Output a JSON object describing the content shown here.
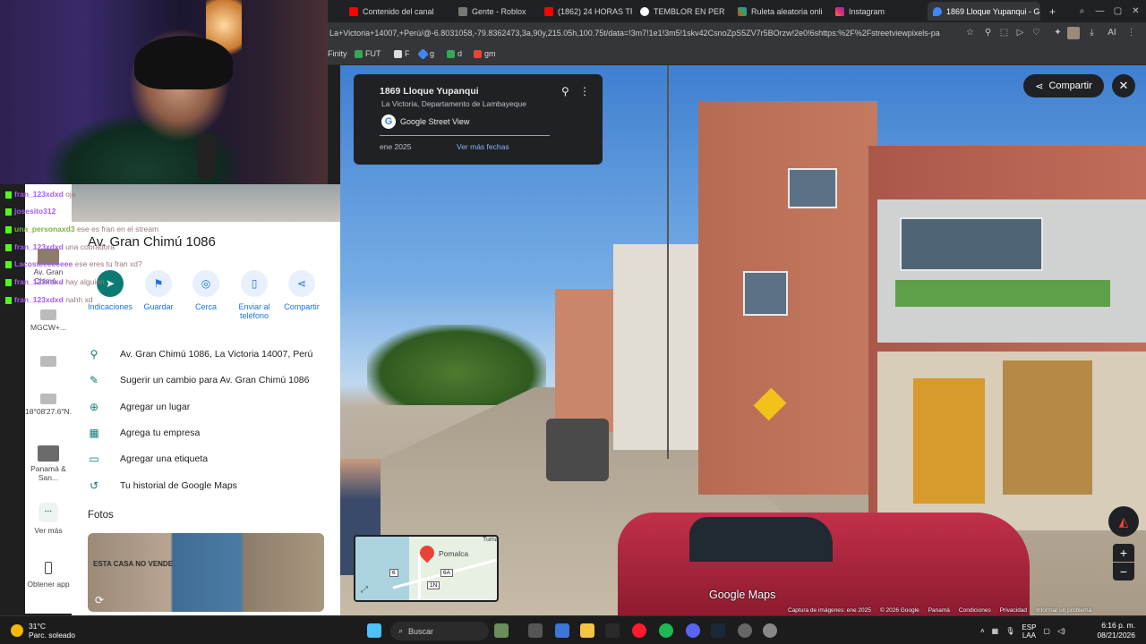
{
  "browser": {
    "tabs": [
      {
        "label": "Contenido del canal",
        "color": "#ff0000"
      },
      {
        "label": "Gente - Roblox",
        "color": "#555555"
      },
      {
        "label": "(1862) 24 HORAS TR",
        "color": "#ff0000"
      },
      {
        "label": "TEMBLOR EN PERU",
        "color": "#34a853"
      },
      {
        "label": "Ruleta aleatoria onlin",
        "color": "#9c27b0"
      },
      {
        "label": "Instagram",
        "color": "#e1306c"
      },
      {
        "label": "1869 Lloque Yupanqui - G",
        "color": "#4285f4"
      }
    ],
    "new_tab": "+",
    "url": "La+Victoria+14007,+Perú/@-6.8031058,-79.8362473,3a,90y,215.05h,100.75t/data=!3m7!1e1!3m5!1skv42CsnoZpS5ZV7r5BOrzw!2e0!6shttps:%2F%2Fstreetviewpixels-pa",
    "ai_label": "AI",
    "bookmarks": [
      {
        "label": "Finity",
        "color": ""
      },
      {
        "label": "FUT",
        "color": "#34a853"
      },
      {
        "label": "F",
        "color": "#4285f4"
      },
      {
        "label": "g",
        "color": "#4285f4"
      },
      {
        "label": "d",
        "color": "#34a853"
      },
      {
        "label": "gm",
        "color": "#ea4335"
      }
    ]
  },
  "chat": [
    {
      "user": "fran_123xdxd",
      "msg": "oja"
    },
    {
      "user": "josesito312",
      "msg": ""
    },
    {
      "user": "una_personaxd3",
      "msg": "ese es fran en el stream"
    },
    {
      "user": "fran_123xdxd",
      "msg": "una cobradora"
    },
    {
      "user": "Lacosteeeeeeee",
      "msg": "ese eres tu fran xd?"
    },
    {
      "user": "fran_123xdxd",
      "msg": "hay alguien"
    },
    {
      "user": "fran_123xdxd",
      "msg": "nahh xd"
    }
  ],
  "rail": {
    "items": [
      {
        "label": "Av. Gran Chimú..."
      },
      {
        "label": "MGCW+..."
      },
      {
        "label": ""
      },
      {
        "label": "18°08'27.6\"N..."
      },
      {
        "label": "Panamá & San..."
      },
      {
        "label": "Ver más"
      },
      {
        "label": "Obtener app"
      }
    ]
  },
  "place": {
    "title": "Av. Gran Chimú 1086",
    "actions": [
      {
        "label": "Indicaciones"
      },
      {
        "label": "Guardar"
      },
      {
        "label": "Cerca"
      },
      {
        "label": "Enviar al teléfono"
      },
      {
        "label": "Compartir"
      }
    ],
    "info": [
      {
        "icon": "location-pin-icon",
        "text": "Av. Gran Chimú 1086, La Victoria 14007, Perú"
      },
      {
        "icon": "pencil-icon",
        "text": "Sugerir un cambio para Av. Gran Chimú 1086"
      },
      {
        "icon": "add-location-icon",
        "text": "Agregar un lugar"
      },
      {
        "icon": "business-icon",
        "text": "Agrega tu empresa"
      },
      {
        "icon": "label-icon",
        "text": "Agregar una etiqueta"
      },
      {
        "icon": "history-icon",
        "text": "Tu historial de Google Maps"
      }
    ],
    "photos_title": "Fotos",
    "photo_graffiti": "ESTA CASA NO VENDE"
  },
  "streetview": {
    "card_title": "1869 Lloque Yupanqui",
    "card_subtitle": "La Victoria, Departamento de Lambayeque",
    "card_source": "Google Street View",
    "card_date": "ene 2025",
    "card_more": "Ver más fechas",
    "share_label": "Compartir",
    "minimap_label": "Pomalca",
    "minimap_label2": "Tuma",
    "route_shields": [
      "6",
      "6A",
      "1N"
    ],
    "logo": "Google Maps",
    "footer": [
      "Captura de imágenes: ene 2025",
      "© 2026 Google",
      "Panamá",
      "Condiciones",
      "Privacidad",
      "Informar un problema"
    ]
  },
  "taskbar": {
    "temp": "31°C",
    "weather": "Parc. soleado",
    "search": "Buscar",
    "lang": "ESP",
    "lang2": "LAA",
    "time": "6:16 p. m.",
    "date": "08/21/2026"
  }
}
